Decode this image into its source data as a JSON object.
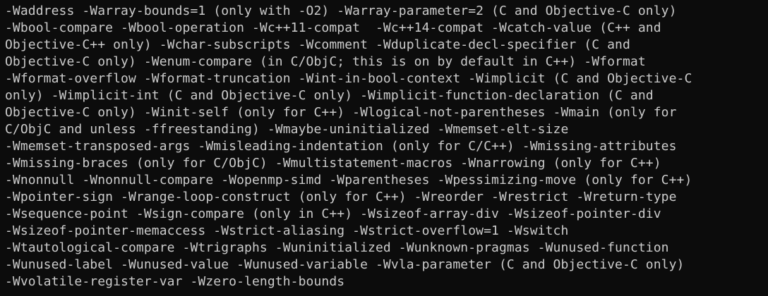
{
  "terminal": {
    "lines": [
      "-Waddress -Warray-bounds=1 (only with -O2) -Warray-parameter=2 (C and Objective-C only)",
      "-Wbool-compare -Wbool-operation -Wc++11-compat  -Wc++14-compat -Wcatch-value (C++ and",
      "Objective-C++ only) -Wchar-subscripts -Wcomment -Wduplicate-decl-specifier (C and",
      "Objective-C only) -Wenum-compare (in C/ObjC; this is on by default in C++) -Wformat",
      "-Wformat-overflow -Wformat-truncation -Wint-in-bool-context -Wimplicit (C and Objective-C",
      "only) -Wimplicit-int (C and Objective-C only) -Wimplicit-function-declaration (C and",
      "Objective-C only) -Winit-self (only for C++) -Wlogical-not-parentheses -Wmain (only for",
      "C/ObjC and unless -ffreestanding) -Wmaybe-uninitialized -Wmemset-elt-size",
      "-Wmemset-transposed-args -Wmisleading-indentation (only for C/C++) -Wmissing-attributes",
      "-Wmissing-braces (only for C/ObjC) -Wmultistatement-macros -Wnarrowing (only for C++)",
      "-Wnonnull -Wnonnull-compare -Wopenmp-simd -Wparentheses -Wpessimizing-move (only for C++)",
      "-Wpointer-sign -Wrange-loop-construct (only for C++) -Wreorder -Wrestrict -Wreturn-type",
      "-Wsequence-point -Wsign-compare (only in C++) -Wsizeof-array-div -Wsizeof-pointer-div",
      "-Wsizeof-pointer-memaccess -Wstrict-aliasing -Wstrict-overflow=1 -Wswitch",
      "-Wtautological-compare -Wtrigraphs -Wuninitialized -Wunknown-pragmas -Wunused-function",
      "-Wunused-label -Wunused-value -Wunused-variable -Wvla-parameter (C and Objective-C only)",
      "-Wvolatile-register-var -Wzero-length-bounds"
    ],
    "colors": {
      "background": "#0c0c0c",
      "foreground": "#cccccc"
    }
  }
}
